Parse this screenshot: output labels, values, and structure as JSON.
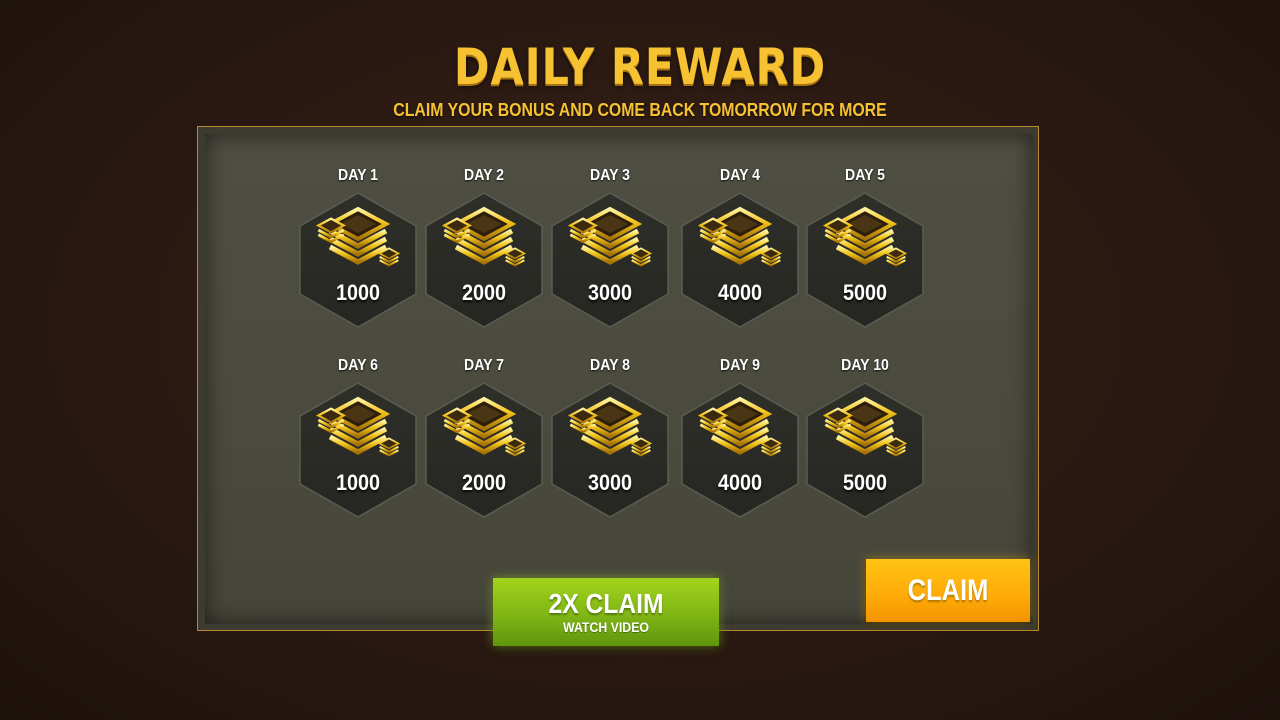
{
  "header": {
    "title": "DAILY REWARD",
    "subtitle": "CLAIM YOUR BONUS AND COME BACK TOMORROW FOR MORE"
  },
  "rewards": [
    {
      "day": "DAY 1",
      "amount": "1000"
    },
    {
      "day": "DAY 2",
      "amount": "2000"
    },
    {
      "day": "DAY 3",
      "amount": "3000"
    },
    {
      "day": "DAY 4",
      "amount": "4000"
    },
    {
      "day": "DAY 5",
      "amount": "5000"
    },
    {
      "day": "DAY 6",
      "amount": "1000"
    },
    {
      "day": "DAY 7",
      "amount": "2000"
    },
    {
      "day": "DAY 8",
      "amount": "3000"
    },
    {
      "day": "DAY 9",
      "amount": "4000"
    },
    {
      "day": "DAY 10",
      "amount": "5000"
    }
  ],
  "reward_icon": "gold-stack-icon",
  "buttons": {
    "double_claim_label": "2X CLAIM",
    "double_claim_sub": "WATCH VIDEO",
    "claim_label": "CLAIM"
  },
  "colors": {
    "title": "#f7c232",
    "gold": "#f2b817",
    "video_button": "#8cc21a",
    "claim_button": "#ffaa08"
  }
}
